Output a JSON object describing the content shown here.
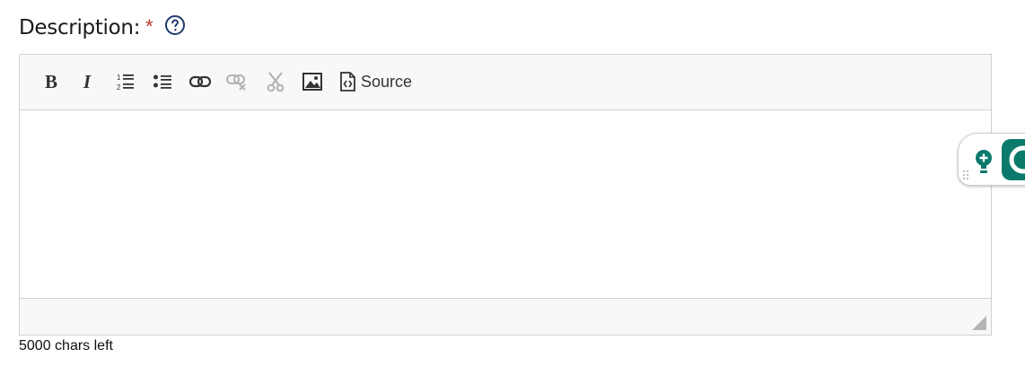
{
  "field": {
    "label": "Description:",
    "required_mark": "*",
    "help_icon": "question-circle-icon"
  },
  "toolbar": {
    "bold_label": "B",
    "italic_label": "I",
    "numbered_list_icon": "numbered-list-icon",
    "bulleted_list_icon": "bulleted-list-icon",
    "link_icon": "link-icon",
    "unlink_icon": "unlink-icon",
    "cut_icon": "scissors-icon",
    "image_icon": "image-icon",
    "source_icon": "source-code-icon",
    "source_label": "Source"
  },
  "editor": {
    "content": ""
  },
  "footer": {
    "chars_left": "5000 chars left"
  },
  "widget": {
    "bulb_icon": "lightbulb-plus-icon",
    "app_icon": "grammar-app-icon",
    "brand_color": "#0b7a6c"
  },
  "colors": {
    "required": "#c0392b",
    "toolbar_bg": "#f8f8f8",
    "border": "#d1d1d1"
  }
}
